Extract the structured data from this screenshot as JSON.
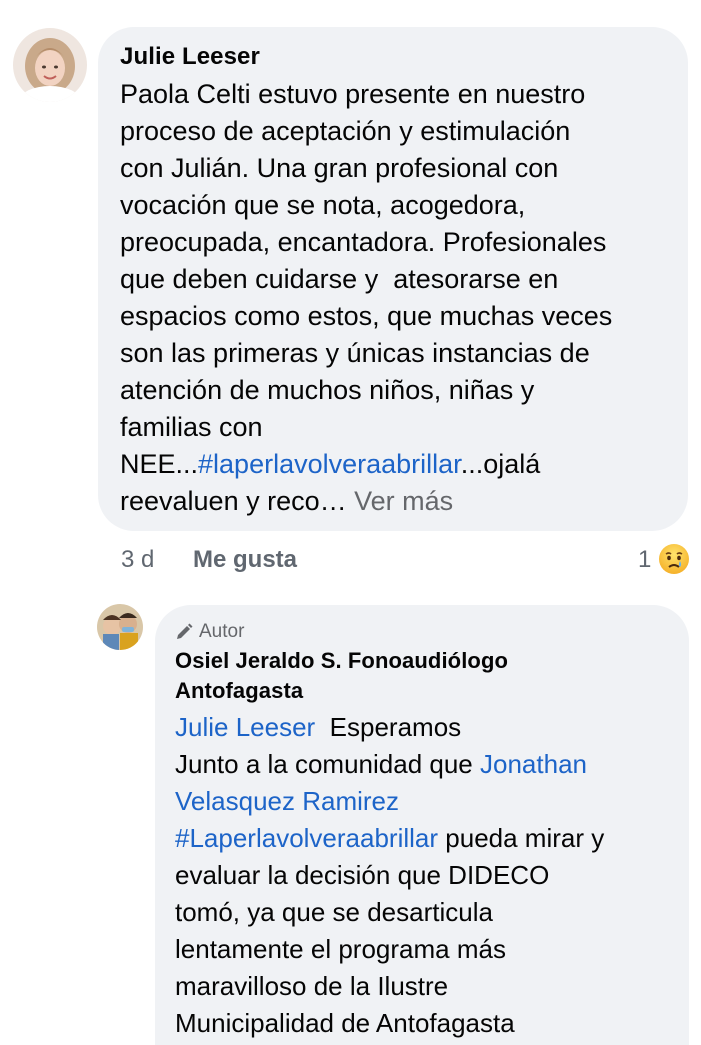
{
  "comment": {
    "author": "Julie Leeser",
    "text_segments": [
      {
        "text": "Paola Celti estuvo presente en nuestro\nproceso de aceptación y estimulación\ncon Julián. Una gran profesional con\nvocación que se nota, acogedora,\npreocupada, encantadora. Profesionales\nque deben cuidarse y  atesorarse en\nespacios como estos, que muchas veces\nson las primeras y únicas instancias de\natención de muchos niños, niñas y\nfamilias con\nNEE...",
        "type": "text"
      },
      {
        "text": "#laperlavolveraabrillar",
        "type": "link"
      },
      {
        "text": "...ojalá\nreevaluen y reco…",
        "type": "text"
      },
      {
        "text": " Ver más",
        "type": "more"
      }
    ],
    "time": "3 d",
    "like_label": "Me gusta",
    "reaction_count": "1",
    "reaction_icon": "sad-crying-emoji-icon"
  },
  "reply": {
    "badge_label": "Autor",
    "badge_icon": "pencil-icon",
    "author_line1": "Osiel Jeraldo S. Fonoaudiólogo",
    "author_line2": "Antofagasta",
    "text_segments": [
      {
        "text": "Julie Leeser",
        "type": "link"
      },
      {
        "text": "  Esperamos\nJunto a la comunidad que ",
        "type": "text"
      },
      {
        "text": "Jonathan\nVelasquez Ramirez",
        "type": "link"
      },
      {
        "text": "\n",
        "type": "text"
      },
      {
        "text": "#Laperlavolveraabrillar",
        "type": "link"
      },
      {
        "text": " pueda mirar y\nevaluar la decisión que DIDECO\ntomó, ya que se desarticula\nlentamente el programa más\nmaravilloso de la Ilustre\nMunicipalidad de Antofagasta",
        "type": "text"
      }
    ]
  },
  "colors": {
    "bubble": "#f0f2f5",
    "link": "#1d64c8",
    "muted": "#65676b"
  }
}
